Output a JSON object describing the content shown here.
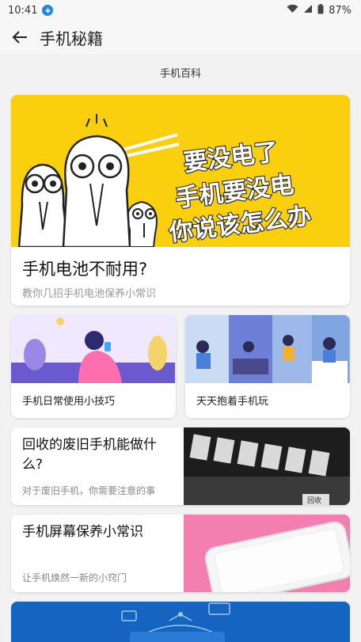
{
  "status": {
    "time": "10:41",
    "battery": "87%"
  },
  "appbar": {
    "title": "手机秘籍"
  },
  "section": {
    "label": "手机百科"
  },
  "hero": {
    "title": "手机电池不耐用?",
    "subtitle": "教你几招手机电池保养小常识",
    "banner_lines": [
      "要没电了",
      "手机要没电",
      "你说该怎么办"
    ]
  },
  "tiles": [
    {
      "label": "手机日常使用小技巧"
    },
    {
      "label": "天天抱着手机玩"
    }
  ],
  "articles": [
    {
      "title": "回收的废旧手机能做什么?",
      "desc": "对于废旧手机，你需要注意的事",
      "tag": "回收"
    },
    {
      "title": "手机屏幕保养小常识",
      "desc": "让手机焕然一新的小窍门"
    }
  ]
}
